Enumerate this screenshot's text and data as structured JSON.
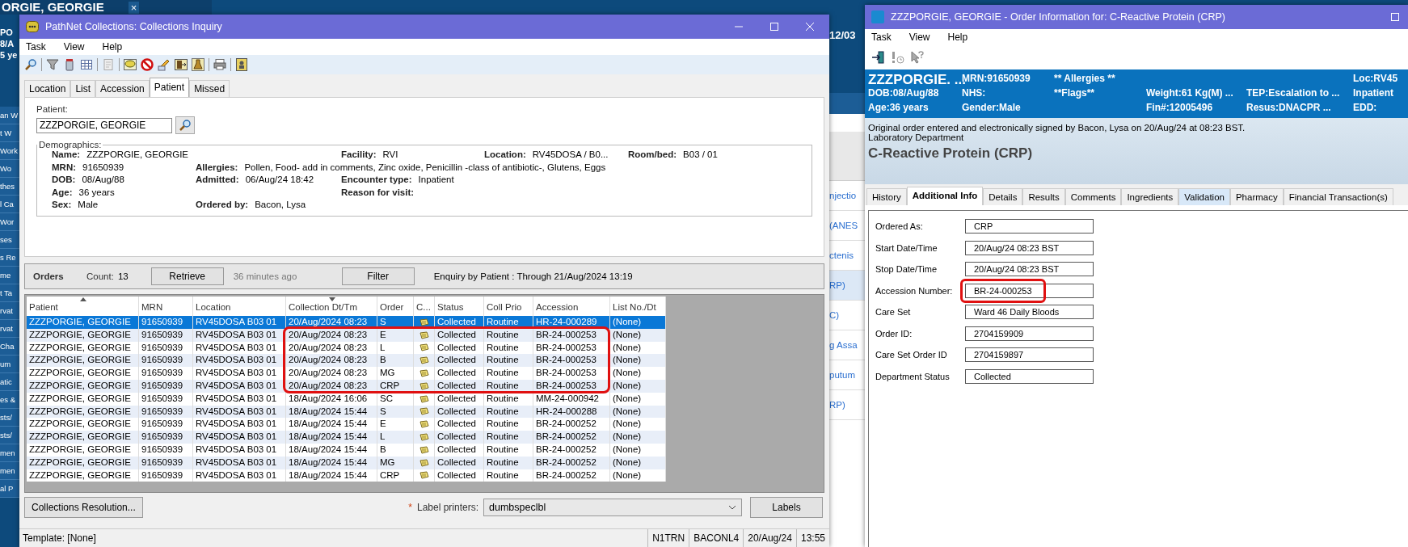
{
  "background": {
    "top_title": "ORGIE, GEORGIE",
    "close_glyph": "×",
    "banner_lines": [
      "PO",
      "8/A",
      "5 ye"
    ],
    "nav_items": [
      "an W",
      "t W",
      "Work",
      "Wo",
      "thes",
      "l Ca",
      "Wor",
      "ses",
      "s Re",
      "me",
      "t Ta",
      "rvat",
      "rvat",
      "Cha",
      "um",
      "atic",
      "es &",
      "sts/",
      "sts/",
      "men",
      "men",
      "al P"
    ],
    "middle_date": "12/03",
    "middle_links": [
      "njectio",
      "(ANES",
      "ctenis",
      "RP)",
      "C)",
      "g Assa",
      "putum",
      "RP)"
    ]
  },
  "collections_window": {
    "title": "PathNet Collections: Collections Inquiry",
    "menu": [
      "Task",
      "View",
      "Help"
    ],
    "tabs": [
      {
        "label": "Location",
        "selected": false
      },
      {
        "label": "List",
        "selected": false
      },
      {
        "label": "Accession",
        "selected": false
      },
      {
        "label": "Patient",
        "selected": true
      },
      {
        "label": "Missed",
        "selected": false
      }
    ],
    "patient_label": "Patient:",
    "patient_value": "ZZZPORGIE, GEORGIE",
    "demographics": {
      "title": "Demographics:",
      "rows": [
        [
          {
            "label": "Name:",
            "value": "ZZZPORGIE, GEORGIE"
          },
          {
            "kind": "empty"
          },
          {
            "label": "Facility:",
            "value": "RVI"
          },
          {
            "label": "Location:",
            "value": "RV45DOSA / B0..."
          },
          {
            "label": "Room/bed:",
            "value": "B03 / 01"
          }
        ],
        [
          {
            "label": "MRN:",
            "value": "91650939"
          },
          {
            "label": "Allergies:",
            "value": "Pollen, Food- add in comments, Zinc oxide, Penicillin -class of antibiotic-, Glutens, Eggs",
            "kind": "wide"
          }
        ],
        [
          {
            "label": "DOB:",
            "value": "08/Aug/88"
          },
          {
            "label": "Admitted:",
            "value": "06/Aug/24 18:42"
          },
          {
            "label": "Encounter type:",
            "value": "Inpatient"
          }
        ],
        [
          {
            "label": "Age:",
            "value": "36 years"
          },
          {
            "kind": "empty"
          },
          {
            "label": "Reason for visit:"
          }
        ],
        [
          {
            "label": "Sex:",
            "value": "Male"
          },
          {
            "label": "Ordered by:",
            "value": "Bacon, Lysa"
          }
        ]
      ]
    },
    "orders_bar": {
      "title": "Orders",
      "count_label": "Count:",
      "count": "13",
      "retrieve": "Retrieve",
      "age": "36 minutes ago",
      "filter": "Filter",
      "enquiry": "Enquiry by Patient : Through 21/Aug/2024 13:19"
    },
    "table": {
      "columns": [
        {
          "label": "Patient",
          "sort_up": true,
          "sort_down": false
        },
        {
          "label": "MRN",
          "sort_up": false,
          "sort_down": false
        },
        {
          "label": "Location",
          "sort_up": false,
          "sort_down": false
        },
        {
          "label": "Collection Dt/Tm",
          "sort_up": false,
          "sort_down": true
        },
        {
          "label": "Order",
          "sort_up": false,
          "sort_down": false
        },
        {
          "label": "C...",
          "sort_up": false,
          "sort_down": false,
          "kind": "icon"
        },
        {
          "label": "Status",
          "sort_up": false,
          "sort_down": false
        },
        {
          "label": "Coll Prio",
          "sort_up": false,
          "sort_down": false
        },
        {
          "label": "Accession",
          "sort_up": false,
          "sort_down": false
        },
        {
          "label": "List No./Dt",
          "sort_up": false,
          "sort_down": false
        }
      ],
      "rows": [
        {
          "cells": [
            "ZZZPORGIE, GEORGIE",
            "91650939",
            "RV45DOSA B03 01",
            "20/Aug/2024 08:23",
            "S",
            "",
            "Collected",
            "Routine",
            "HR-24-000289",
            "(None)"
          ],
          "selected": true,
          "outlined": false
        },
        {
          "cells": [
            "ZZZPORGIE, GEORGIE",
            "91650939",
            "RV45DOSA B03 01",
            "20/Aug/2024 08:23",
            "E",
            "",
            "Collected",
            "Routine",
            "BR-24-000253",
            "(None)"
          ],
          "selected": false,
          "outlined": true
        },
        {
          "cells": [
            "ZZZPORGIE, GEORGIE",
            "91650939",
            "RV45DOSA B03 01",
            "20/Aug/2024 08:23",
            "L",
            "",
            "Collected",
            "Routine",
            "BR-24-000253",
            "(None)"
          ],
          "selected": false,
          "outlined": true
        },
        {
          "cells": [
            "ZZZPORGIE, GEORGIE",
            "91650939",
            "RV45DOSA B03 01",
            "20/Aug/2024 08:23",
            "B",
            "",
            "Collected",
            "Routine",
            "BR-24-000253",
            "(None)"
          ],
          "selected": false,
          "outlined": true
        },
        {
          "cells": [
            "ZZZPORGIE, GEORGIE",
            "91650939",
            "RV45DOSA B03 01",
            "20/Aug/2024 08:23",
            "MG",
            "",
            "Collected",
            "Routine",
            "BR-24-000253",
            "(None)"
          ],
          "selected": false,
          "outlined": true
        },
        {
          "cells": [
            "ZZZPORGIE, GEORGIE",
            "91650939",
            "RV45DOSA B03 01",
            "20/Aug/2024 08:23",
            "CRP",
            "",
            "Collected",
            "Routine",
            "BR-24-000253",
            "(None)"
          ],
          "selected": false,
          "outlined": true
        },
        {
          "cells": [
            "ZZZPORGIE, GEORGIE",
            "91650939",
            "RV45DOSA B03 01",
            "18/Aug/2024 16:06",
            "SC",
            "",
            "Collected",
            "Routine",
            "MM-24-000942",
            "(None)"
          ],
          "selected": false,
          "outlined": false
        },
        {
          "cells": [
            "ZZZPORGIE, GEORGIE",
            "91650939",
            "RV45DOSA B03 01",
            "18/Aug/2024 15:44",
            "S",
            "",
            "Collected",
            "Routine",
            "HR-24-000288",
            "(None)"
          ],
          "selected": false,
          "outlined": false
        },
        {
          "cells": [
            "ZZZPORGIE, GEORGIE",
            "91650939",
            "RV45DOSA B03 01",
            "18/Aug/2024 15:44",
            "E",
            "",
            "Collected",
            "Routine",
            "BR-24-000252",
            "(None)"
          ],
          "selected": false,
          "outlined": false
        },
        {
          "cells": [
            "ZZZPORGIE, GEORGIE",
            "91650939",
            "RV45DOSA B03 01",
            "18/Aug/2024 15:44",
            "L",
            "",
            "Collected",
            "Routine",
            "BR-24-000252",
            "(None)"
          ],
          "selected": false,
          "outlined": false
        },
        {
          "cells": [
            "ZZZPORGIE, GEORGIE",
            "91650939",
            "RV45DOSA B03 01",
            "18/Aug/2024 15:44",
            "B",
            "",
            "Collected",
            "Routine",
            "BR-24-000252",
            "(None)"
          ],
          "selected": false,
          "outlined": false
        },
        {
          "cells": [
            "ZZZPORGIE, GEORGIE",
            "91650939",
            "RV45DOSA B03 01",
            "18/Aug/2024 15:44",
            "MG",
            "",
            "Collected",
            "Routine",
            "BR-24-000252",
            "(None)"
          ],
          "selected": false,
          "outlined": false
        },
        {
          "cells": [
            "ZZZPORGIE, GEORGIE",
            "91650939",
            "RV45DOSA B03 01",
            "18/Aug/2024 15:44",
            "CRP",
            "",
            "Collected",
            "Routine",
            "BR-24-000252",
            "(None)"
          ],
          "selected": false,
          "outlined": false
        }
      ]
    },
    "bottom_bar": {
      "resolution_button": "Collections Resolution...",
      "required_mark": "*",
      "printer_label": "Label printers:",
      "printer_value": "dumbspeclbl",
      "labels_button": "Labels"
    },
    "status_bar": {
      "template": "Template: [None]",
      "panes": [
        "N1TRN",
        "BACONL4",
        "20/Aug/24",
        "13:55"
      ]
    }
  },
  "order_window": {
    "title": "ZZZPORGIE, GEORGIE  - Order Information for: C-Reactive Protein (CRP)",
    "menu": [
      "Task",
      "View",
      "Help"
    ],
    "banner": [
      [
        {
          "text": "ZZZPORGIE. ...",
          "kind": "name"
        },
        {
          "text": "MRN:91650939"
        },
        {
          "text": "** Allergies **"
        },
        {
          "kind": "empty"
        },
        {
          "kind": "empty"
        },
        {
          "text": "Loc:RV45"
        }
      ],
      [
        {
          "text": "DOB:08/Aug/88"
        },
        {
          "text": "NHS:"
        },
        {
          "text": "**Flags**"
        },
        {
          "text": "Weight:61 Kg(M) ..."
        },
        {
          "text": "TEP:Escalation to ..."
        },
        {
          "text": "Inpatient"
        }
      ],
      [
        {
          "text": "Age:36 years"
        },
        {
          "text": "Gender:Male"
        },
        {
          "kind": "empty"
        },
        {
          "text": "Fin#:12005496"
        },
        {
          "text": "Resus:DNACPR  ..."
        },
        {
          "text": "EDD:"
        }
      ]
    ],
    "signed_text": "Original order entered and electronically signed by Bacon, Lysa on 20/Aug/24 at 08:23 BST.",
    "department": "Laboratory Department",
    "order_name": "C-Reactive Protein (CRP)",
    "tabs": [
      {
        "label": "History",
        "selected": false,
        "highlighted": false
      },
      {
        "label": "Additional Info",
        "selected": true,
        "highlighted": false
      },
      {
        "label": "Details",
        "selected": false,
        "highlighted": false
      },
      {
        "label": "Results",
        "selected": false,
        "highlighted": false
      },
      {
        "label": "Comments",
        "selected": false,
        "highlighted": false
      },
      {
        "label": "Ingredients",
        "selected": false,
        "highlighted": false
      },
      {
        "label": "Validation",
        "selected": false,
        "highlighted": true
      },
      {
        "label": "Pharmacy",
        "selected": false,
        "highlighted": false
      },
      {
        "label": "Financial Transaction(s)",
        "selected": false,
        "highlighted": false
      }
    ],
    "fields": [
      {
        "label": "Ordered As:",
        "value": "CRP",
        "outlined": false
      },
      {
        "label": "Start Date/Time",
        "value": "20/Aug/24  08:23 BST",
        "outlined": false
      },
      {
        "label": "Stop Date/Time",
        "value": "20/Aug/24  08:23 BST",
        "outlined": false
      },
      {
        "label": "Accession Number:",
        "value": "BR-24-000253",
        "outlined": true
      },
      {
        "label": "Care Set",
        "value": "Ward 46 Daily Bloods",
        "outlined": false
      },
      {
        "label": "Order ID:",
        "value": "2704159909",
        "outlined": false
      },
      {
        "label": "Care Set Order ID",
        "value": "2704159897",
        "outlined": false
      },
      {
        "label": "Department Status",
        "value": "Collected",
        "outlined": false
      }
    ]
  }
}
